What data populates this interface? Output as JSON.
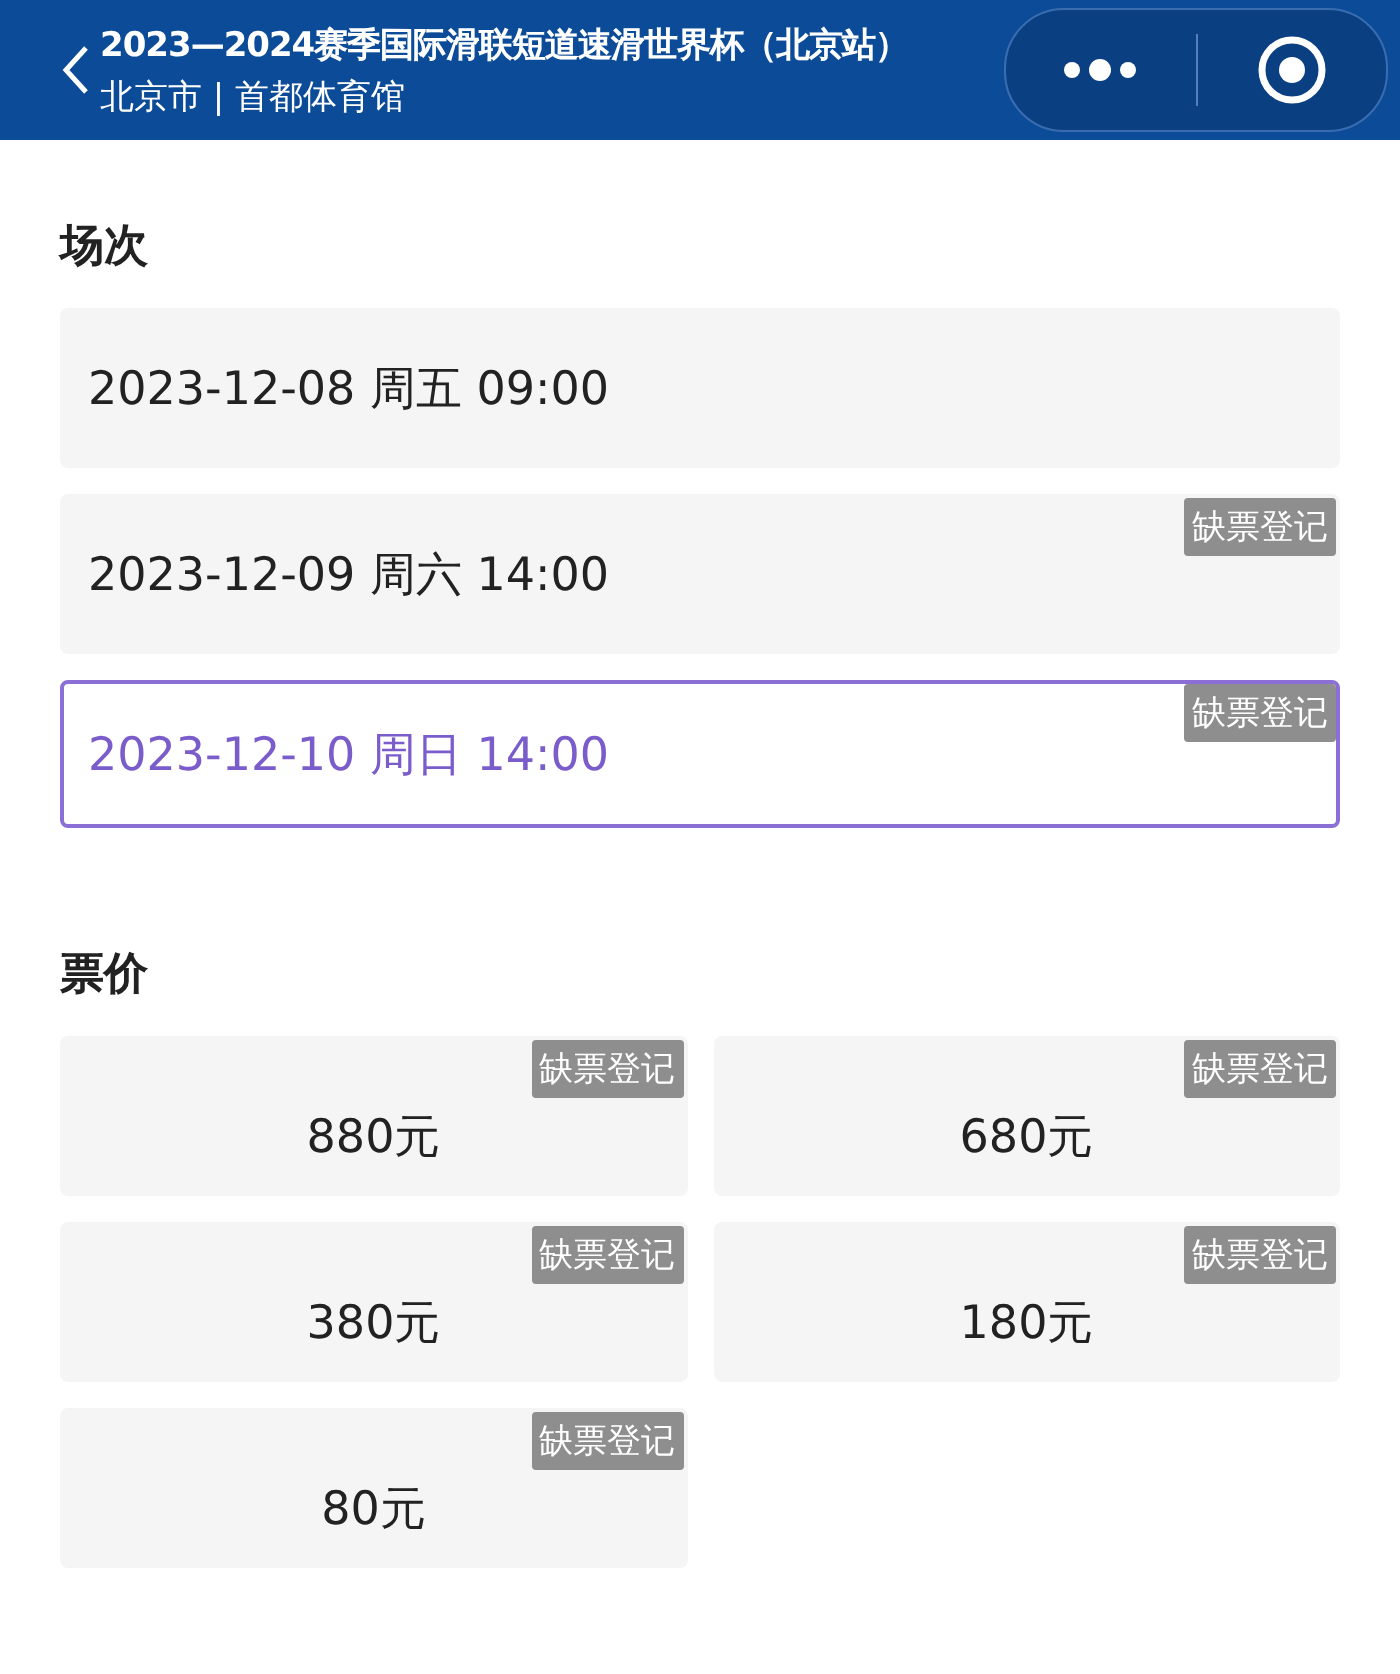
{
  "header": {
    "title": "2023—2024赛季国际滑联短道速滑世界杯（北京站）",
    "subtitle": "北京市 | 首都体育馆"
  },
  "sessions": {
    "title": "场次",
    "items": [
      {
        "label": "2023-12-08 周五 09:00",
        "selected": false
      },
      {
        "label": "2023-12-09 周六 14:00",
        "selected": false,
        "badge": "缺票登记"
      },
      {
        "label": "2023-12-10 周日 14:00",
        "selected": true,
        "badge": "缺票登记"
      }
    ]
  },
  "prices": {
    "title": "票价",
    "items": [
      {
        "label": "880元",
        "selected": false,
        "badge": "缺票登记"
      },
      {
        "label": "680元",
        "selected": false,
        "badge": "缺票登记"
      },
      {
        "label": "380元",
        "selected": false,
        "badge": "缺票登记"
      },
      {
        "label": "180元",
        "selected": false,
        "badge": "缺票登记"
      },
      {
        "label": "80元",
        "selected": false,
        "badge": "缺票登记"
      }
    ]
  }
}
